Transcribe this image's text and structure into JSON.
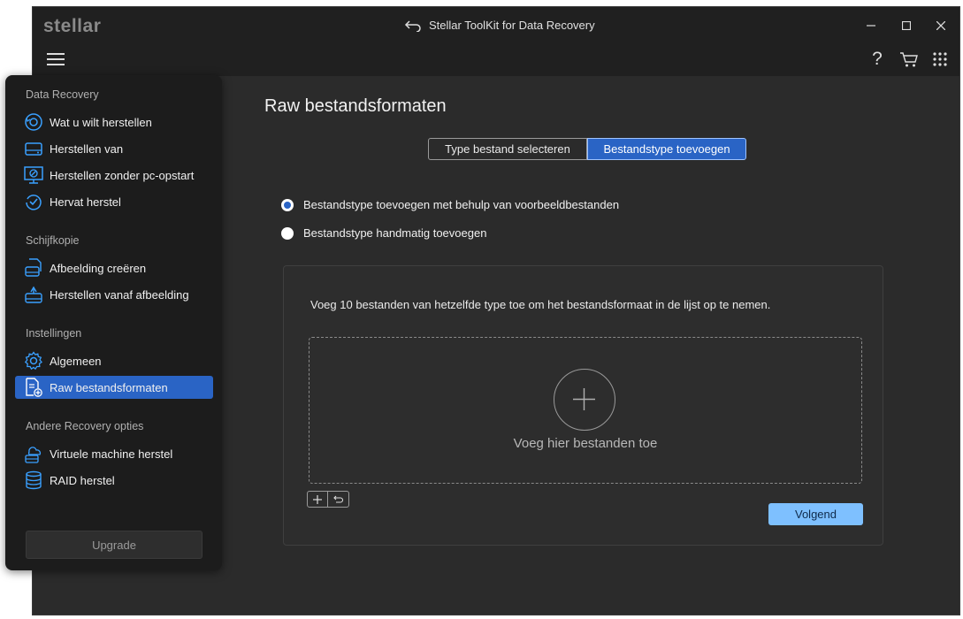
{
  "app": {
    "logo": "stellar",
    "title": "Stellar ToolKit for Data Recovery",
    "window_controls": [
      "–",
      "☐",
      "✕"
    ]
  },
  "toolbar": {
    "icons": [
      "menu-icon",
      "help-icon",
      "cart-icon",
      "apps-grid-icon"
    ],
    "help": "?"
  },
  "sidebar": {
    "sections": [
      {
        "title": "Data Recovery",
        "items": [
          {
            "label": "Wat u wilt herstellen",
            "icon": "restore-icon"
          },
          {
            "label": "Herstellen van",
            "icon": "drive-icon"
          },
          {
            "label": "Herstellen zonder pc-opstart",
            "icon": "monitor-icon"
          },
          {
            "label": "Hervat herstel",
            "icon": "resume-icon"
          }
        ]
      },
      {
        "title": "Schijfkopie",
        "items": [
          {
            "label": "Afbeelding creëren",
            "icon": "create-image-icon"
          },
          {
            "label": "Herstellen vanaf afbeelding",
            "icon": "restore-image-icon"
          }
        ]
      },
      {
        "title": "Instellingen",
        "items": [
          {
            "label": "Algemeen",
            "icon": "gear-icon"
          },
          {
            "label": "Raw bestandsformaten",
            "icon": "raw-file-icon",
            "active": true
          }
        ]
      },
      {
        "title": "Andere Recovery opties",
        "items": [
          {
            "label": "Virtuele machine herstel",
            "icon": "virtual-machine-icon"
          },
          {
            "label": "RAID herstel",
            "icon": "raid-icon"
          }
        ]
      }
    ],
    "upgrade_label": "Upgrade"
  },
  "main": {
    "title": "Raw bestandsformaten",
    "tabs": [
      {
        "label": "Type bestand selecteren",
        "active": false
      },
      {
        "label": "Bestandstype toevoegen",
        "active": true
      }
    ],
    "options": [
      {
        "label": "Bestandstype toevoegen met behulp van voorbeeldbestanden",
        "checked": true
      },
      {
        "label": "Bestandstype handmatig toevoegen",
        "checked": false
      }
    ],
    "instruction": "Voeg 10 bestanden van hetzelfde type toe om het bestandsformaat in de lijst op te nemen.",
    "dropzone_label": "Voeg hier bestanden toe",
    "next_label": "Volgend"
  },
  "colors": {
    "accent": "#2a64c5",
    "next_button": "#7ec0ff",
    "icon_blue": "#3aa0ff"
  }
}
